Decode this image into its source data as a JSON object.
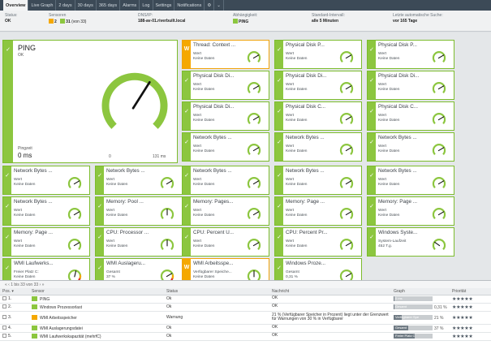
{
  "tabs": [
    "Overview",
    "Live Graph",
    "2 days",
    "30 days",
    "365 days",
    "Alarms",
    "Log",
    "Settings",
    "Notifications",
    "⚙",
    "⌄"
  ],
  "info": {
    "status_label": "Status:",
    "status_value": "OK",
    "sensors_label": "Sensoren",
    "sensors_warn": "2",
    "sensors_ok": "31",
    "sensors_total": "(von 33)",
    "dns_label": "DNS/IP:",
    "dns_value": "188-av-01.riverbuilt.local",
    "dep_label": "Abhängigkeit:",
    "dep_value": "PING",
    "interval_label": "Standard-Intervall:",
    "interval_value": "alle 5 Minuten",
    "lastscan_label": "Letzte automatische Suche:",
    "lastscan_value": "vor 165 Tage"
  },
  "big_sensor": {
    "title": "PING",
    "status": "OK",
    "caption": "Pingzeit",
    "value": "0 ms",
    "gauge_min": "0",
    "gauge_max": "131 ms",
    "gauge_level": 0.62
  },
  "tiles": [
    {
      "name": "Thread: Context ...",
      "l1": "Wert",
      "l2": "Keine Daten",
      "state": "warn"
    },
    {
      "name": "Physical Disk P...",
      "l1": "Wert",
      "l2": "Keine Daten",
      "state": "ok"
    },
    {
      "name": "Physical Disk P...",
      "l1": "Wert",
      "l2": "Keine Daten",
      "state": "ok"
    },
    {
      "name": "Physical Disk Di...",
      "l1": "Wert",
      "l2": "Keine Daten",
      "state": "ok"
    },
    {
      "name": "Physical Disk Di...",
      "l1": "Wert",
      "l2": "Keine Daten",
      "state": "ok"
    },
    {
      "name": "Physical Disk Di...",
      "l1": "Wert",
      "l2": "Keine Daten",
      "state": "ok"
    },
    {
      "name": "Physical Disk Di...",
      "l1": "Wert",
      "l2": "Keine Daten",
      "state": "ok"
    },
    {
      "name": "Physical Disk C...",
      "l1": "Wert",
      "l2": "Keine Daten",
      "state": "ok"
    },
    {
      "name": "Physical Disk C...",
      "l1": "Wert",
      "l2": "Keine Daten",
      "state": "ok"
    },
    {
      "name": "Network Bytes ...",
      "l1": "Wert",
      "l2": "Keine Daten",
      "state": "ok"
    },
    {
      "name": "Network Bytes ...",
      "l1": "Wert",
      "l2": "Keine Daten",
      "state": "ok"
    },
    {
      "name": "Network Bytes ...",
      "l1": "Wert",
      "l2": "Keine Daten",
      "state": "ok"
    },
    {
      "name": "Network Bytes ...",
      "l1": "Wert",
      "l2": "Keine Daten",
      "state": "ok"
    },
    {
      "name": "Network Bytes ...",
      "l1": "Wert",
      "l2": "Keine Daten",
      "state": "ok"
    },
    {
      "name": "Network Bytes ...",
      "l1": "Wert",
      "l2": "Keine Daten",
      "state": "ok"
    },
    {
      "name": "Network Bytes ...",
      "l1": "Wert",
      "l2": "Keine Daten",
      "state": "ok"
    },
    {
      "name": "Network Bytes ...",
      "l1": "Wert",
      "l2": "Keine Daten",
      "state": "ok"
    },
    {
      "name": "Network Bytes ...",
      "l1": "Wert",
      "l2": "Keine Daten",
      "state": "ok"
    },
    {
      "name": "Memory: Pool ...",
      "l1": "Wert",
      "l2": "Keine Daten",
      "state": "ok"
    },
    {
      "name": "Memory: Pages...",
      "l1": "Wert",
      "l2": "Keine Daten",
      "state": "ok"
    },
    {
      "name": "Memory: Page ...",
      "l1": "Wert",
      "l2": "Keine Daten",
      "state": "ok"
    },
    {
      "name": "Memory: Page ...",
      "l1": "Wert",
      "l2": "Keine Daten",
      "state": "ok"
    },
    {
      "name": "Memory: Page ...",
      "l1": "Wert",
      "l2": "Keine Daten",
      "state": "ok"
    },
    {
      "name": "CPU: Processor ...",
      "l1": "Wert",
      "l2": "Keine Daten",
      "state": "ok"
    },
    {
      "name": "CPU: Percent U...",
      "l1": "Wert",
      "l2": "Keine Daten",
      "state": "ok"
    },
    {
      "name": "CPU: Percent Pr...",
      "l1": "Wert",
      "l2": "Keine Daten",
      "state": "ok"
    },
    {
      "name": "Windows Syste...",
      "l1": "System-Laufzeit",
      "l2": "452 T.g.",
      "state": "ok"
    },
    {
      "name": "WMI Laufwerks...",
      "l1": "Freier Platz C:",
      "l2": "Keine Daten",
      "state": "ok"
    },
    {
      "name": "WMI Auslageru...",
      "l1": "Gesamt",
      "l2": "37 %",
      "state": "ok"
    },
    {
      "name": "WMI Arbeitsspe...",
      "l1": "Verfügbarer Speiche...",
      "l2": "Keine Daten",
      "state": "warn"
    },
    {
      "name": "Windows Proze...",
      "l1": "Gesamt",
      "l2": "0,31 %",
      "state": "ok"
    }
  ],
  "table": {
    "pager": "« ‹ 1 bis 33 von 33 › »",
    "headers": [
      "Pos. ▾",
      "Sensor",
      "Status",
      "Nachricht",
      "Graph",
      "Priorität"
    ],
    "rows": [
      {
        "pos": "1.",
        "sensor": "PING",
        "status": "Ok",
        "message": "OK",
        "graph_label": "0 ms",
        "graph_pct": "",
        "graph_fill": 0.02,
        "stars": "★★★★★",
        "state": "ok"
      },
      {
        "pos": "2.",
        "sensor": "Windows Prozessorlast",
        "status": "Ok",
        "message": "OK",
        "graph_label": "Gesamt",
        "graph_pct": "0,31 %",
        "graph_fill": 0.03,
        "stars": "★★★★★",
        "state": "ok"
      },
      {
        "pos": "3.",
        "sensor": "WMI Arbeitsspeicher",
        "status": "Warnung",
        "message": "21 % (Verfügbarer Speicher in Prozent) liegt unter der Grenzwert für Warnungen von 30 % in Verfügbarer",
        "graph_label": "Verfügbarer Spe",
        "graph_pct": "21 %",
        "graph_fill": 0.21,
        "stars": "★★★★★",
        "state": "warn"
      },
      {
        "pos": "4.",
        "sensor": "WMI Auslagerungsdatei",
        "status": "Ok",
        "message": "OK",
        "graph_label": "Gesamt",
        "graph_pct": "37 %",
        "graph_fill": 0.37,
        "stars": "★★★★★",
        "state": "ok"
      },
      {
        "pos": "5.",
        "sensor": "WMI Laufwerkskapazität (mehrfC)",
        "status": "Ok",
        "message": "OK",
        "graph_label": "Freier Platz C",
        "graph_pct": "",
        "graph_fill": 0.55,
        "stars": "★★★★★",
        "state": "ok"
      }
    ]
  },
  "colors": {
    "ok": "#8cc63f",
    "warn": "#f5a800",
    "gauge_warn": "#e62e2e"
  }
}
